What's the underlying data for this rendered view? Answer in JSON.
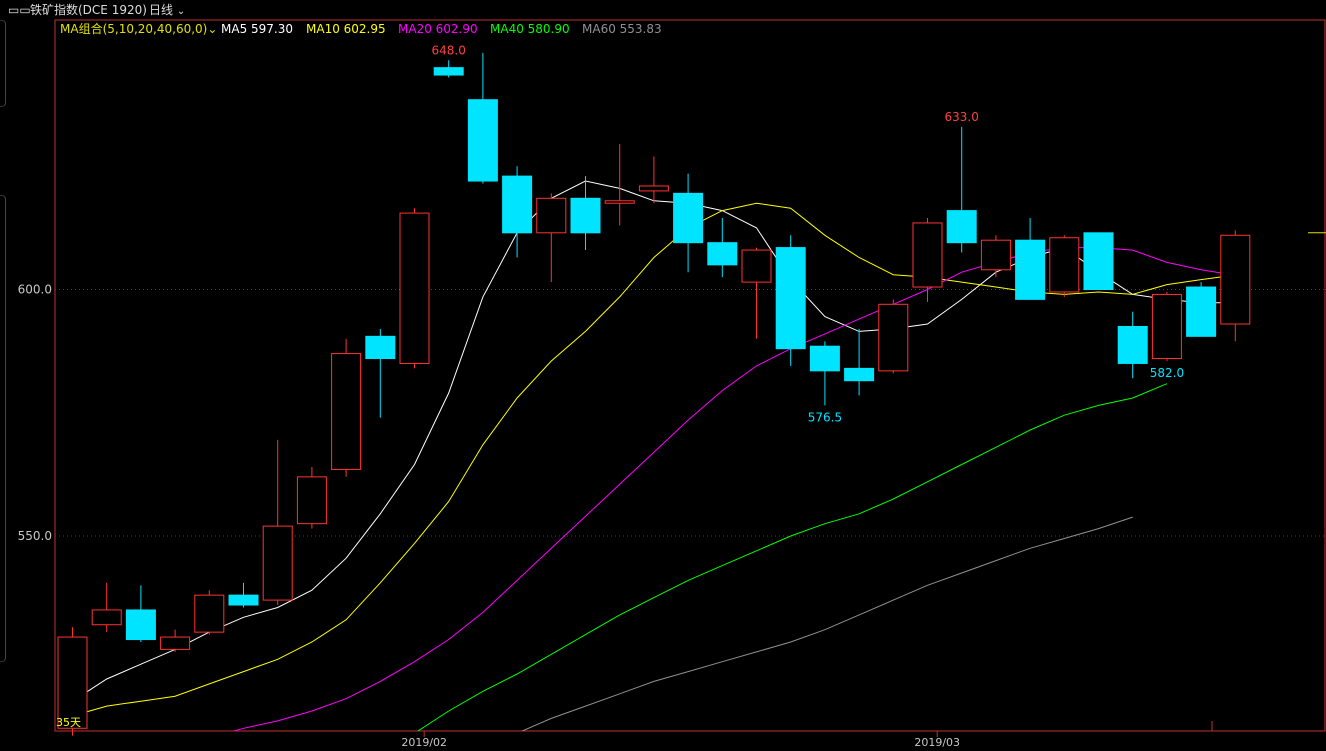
{
  "toolbar": {
    "instrument": "铁矿指数(DCE 1920)",
    "period": "日线"
  },
  "chart_data": {
    "type": "candlestick",
    "title": "铁矿指数(DCE 1920)",
    "period": "日线",
    "ma_legend": {
      "label": "MA组合(5,10,20,40,60,0)",
      "items": [
        {
          "name": "MA5",
          "value": "597.30",
          "color": "#ffffff"
        },
        {
          "name": "MA10",
          "value": "602.95",
          "color": "#ffff00"
        },
        {
          "name": "MA20",
          "value": "602.90",
          "color": "#ff00ff"
        },
        {
          "name": "MA40",
          "value": "580.90",
          "color": "#00ff00"
        },
        {
          "name": "MA60",
          "value": "553.83",
          "color": "#909090"
        }
      ]
    },
    "y_ticks": [
      {
        "value": 600,
        "label": "600.0"
      },
      {
        "value": 550,
        "label": "550.0"
      }
    ],
    "x_ticks": [
      {
        "index": 11,
        "label": "2019/02"
      },
      {
        "index": 26,
        "label": "2019/03"
      }
    ],
    "ylim": [
      506.3,
      657.5
    ],
    "price_annotations": [
      {
        "index": 11,
        "label": "648.0",
        "kind": "high"
      },
      {
        "index": 26,
        "label": "633.0",
        "kind": "high"
      },
      {
        "index": 22,
        "label": "576.5",
        "kind": "low"
      },
      {
        "index": 32,
        "label": "582.0",
        "kind": "low"
      },
      {
        "index": 0,
        "label": "35天",
        "kind": "count"
      }
    ],
    "candles": [
      {
        "o": 511.0,
        "h": 531.5,
        "l": 509.5,
        "c": 529.5
      },
      {
        "o": 532.0,
        "h": 540.5,
        "l": 530.5,
        "c": 535.0
      },
      {
        "o": 535.0,
        "h": 540.0,
        "l": 528.5,
        "c": 529.0
      },
      {
        "o": 527.0,
        "h": 531.0,
        "l": 526.5,
        "c": 529.5
      },
      {
        "o": 530.5,
        "h": 539.0,
        "l": 530.0,
        "c": 538.0
      },
      {
        "o": 538.0,
        "h": 540.5,
        "l": 535.5,
        "c": 536.0
      },
      {
        "o": 537.0,
        "h": 569.5,
        "l": 536.0,
        "c": 552.0
      },
      {
        "o": 552.5,
        "h": 564.0,
        "l": 551.5,
        "c": 562.0
      },
      {
        "o": 563.5,
        "h": 590.0,
        "l": 562.0,
        "c": 587.0
      },
      {
        "o": 590.5,
        "h": 592.0,
        "l": 574.0,
        "c": 586.0
      },
      {
        "o": 585.0,
        "h": 616.5,
        "l": 584.0,
        "c": 615.5
      },
      {
        "o": 645.0,
        "h": 646.5,
        "l": 643.0,
        "c": 643.5
      },
      {
        "o": 638.5,
        "h": 648.0,
        "l": 621.5,
        "c": 622.0
      },
      {
        "o": 623.0,
        "h": 625.0,
        "l": 606.5,
        "c": 611.5
      },
      {
        "o": 611.5,
        "h": 619.5,
        "l": 601.5,
        "c": 618.5
      },
      {
        "o": 618.5,
        "h": 623.0,
        "l": 608.0,
        "c": 611.5
      },
      {
        "o": 617.5,
        "h": 629.5,
        "l": 613.0,
        "c": 618.0
      },
      {
        "o": 620.0,
        "h": 627.0,
        "l": 617.5,
        "c": 621.0
      },
      {
        "o": 619.5,
        "h": 623.5,
        "l": 603.5,
        "c": 609.5
      },
      {
        "o": 609.5,
        "h": 614.5,
        "l": 602.5,
        "c": 605.0
      },
      {
        "o": 601.5,
        "h": 608.5,
        "l": 590.0,
        "c": 608.0
      },
      {
        "o": 608.5,
        "h": 611.0,
        "l": 584.5,
        "c": 588.0
      },
      {
        "o": 588.5,
        "h": 589.5,
        "l": 576.5,
        "c": 583.5
      },
      {
        "o": 584.0,
        "h": 592.0,
        "l": 578.5,
        "c": 581.5
      },
      {
        "o": 583.5,
        "h": 598.0,
        "l": 583.0,
        "c": 597.0
      },
      {
        "o": 600.5,
        "h": 614.5,
        "l": 597.5,
        "c": 613.5
      },
      {
        "o": 616.0,
        "h": 633.0,
        "l": 607.5,
        "c": 609.5
      },
      {
        "o": 604.0,
        "h": 611.0,
        "l": 602.5,
        "c": 610.0
      },
      {
        "o": 610.0,
        "h": 614.5,
        "l": 598.0,
        "c": 598.0
      },
      {
        "o": 599.5,
        "h": 611.0,
        "l": 598.5,
        "c": 610.5
      },
      {
        "o": 611.5,
        "h": 611.5,
        "l": 600.0,
        "c": 600.0
      },
      {
        "o": 592.5,
        "h": 595.5,
        "l": 582.0,
        "c": 585.0
      },
      {
        "o": 586.0,
        "h": 599.5,
        "l": 585.5,
        "c": 599.0
      },
      {
        "o": 600.5,
        "h": 601.5,
        "l": 590.5,
        "c": 590.5
      },
      {
        "o": 593.0,
        "h": 612.0,
        "l": 589.5,
        "c": 611.0
      }
    ],
    "moving_averages": [
      {
        "name": "MA5",
        "color": "#ffffff",
        "start": 0,
        "values": [
          516.5,
          521.0,
          524.0,
          527.0,
          530.5,
          533.5,
          535.5,
          539.0,
          545.5,
          554.5,
          564.5,
          579.0,
          598.5,
          611.5,
          618.5,
          622.0,
          620.5,
          618.0,
          617.5,
          616.0,
          612.5,
          602.0,
          594.5,
          591.5,
          592.0,
          593.0,
          598.0,
          603.5,
          606.5,
          608.5,
          603.5,
          599.0,
          598.0,
          597.3,
          597.3
        ]
      },
      {
        "name": "MA10",
        "color": "#ffff00",
        "start": 0,
        "values": [
          513.5,
          515.5,
          516.5,
          517.5,
          520.0,
          522.5,
          525.0,
          528.5,
          533.0,
          540.5,
          548.5,
          557.0,
          568.5,
          578.0,
          585.5,
          591.5,
          598.5,
          606.5,
          612.5,
          616.0,
          617.5,
          616.5,
          611.0,
          606.5,
          603.0,
          602.5,
          601.5,
          600.5,
          599.5,
          599.0,
          599.5,
          599.0,
          601.0,
          602.0,
          602.95
        ]
      },
      {
        "name": "MA20",
        "color": "#ff00ff",
        "start": 2,
        "values": [
          506.5,
          508.0,
          509.0,
          511.0,
          512.5,
          514.5,
          517.0,
          520.5,
          524.5,
          529.0,
          534.5,
          541.0,
          547.5,
          554.0,
          560.5,
          567.0,
          573.5,
          579.5,
          584.5,
          588.0,
          591.0,
          594.0,
          597.0,
          600.0,
          603.5,
          605.5,
          607.5,
          608.5,
          608.5,
          608.0,
          605.5,
          604.0,
          602.9
        ]
      },
      {
        "name": "MA40",
        "color": "#00ff00",
        "start": 9,
        "values": [
          507.0,
          510.0,
          514.5,
          518.5,
          522.0,
          526.0,
          530.0,
          534.0,
          537.5,
          541.0,
          544.0,
          547.0,
          550.0,
          552.5,
          554.5,
          557.5,
          561.0,
          564.5,
          568.0,
          571.5,
          574.5,
          576.5,
          578.0,
          580.9
        ]
      },
      {
        "name": "MA60",
        "color": "#909090",
        "start": 12,
        "values": [
          507.0,
          510.0,
          513.0,
          515.5,
          518.0,
          520.5,
          522.5,
          524.5,
          526.5,
          528.5,
          531.0,
          534.0,
          537.0,
          540.0,
          542.5,
          545.0,
          547.5,
          549.5,
          551.5,
          553.83
        ]
      }
    ]
  }
}
